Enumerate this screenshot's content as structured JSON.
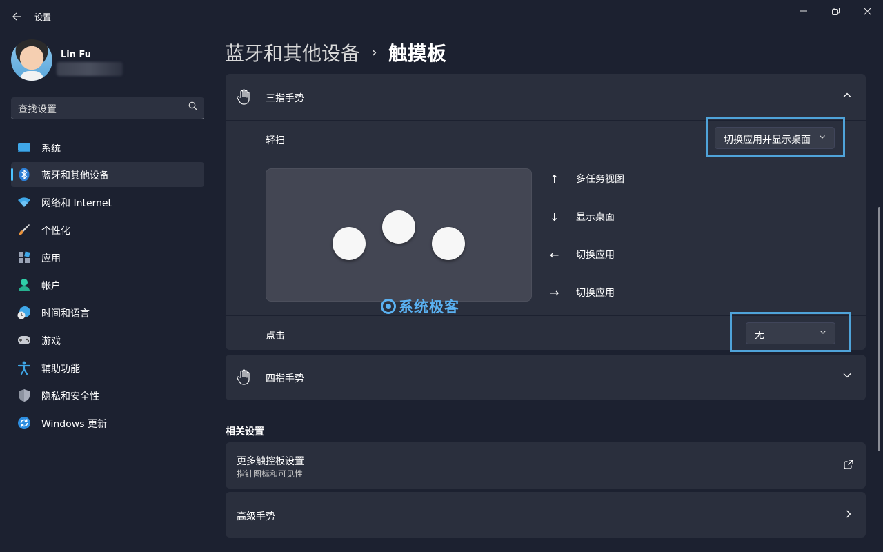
{
  "window": {
    "app_title": "设置",
    "controls": {
      "minimize": "─",
      "maximize": "❐",
      "close": "✕"
    }
  },
  "profile": {
    "name": "Lin Fu"
  },
  "search": {
    "placeholder": "查找设置"
  },
  "sidebar": {
    "items": [
      {
        "label": "系统",
        "icon": "monitor-icon"
      },
      {
        "label": "蓝牙和其他设备",
        "icon": "bluetooth-icon",
        "active": true
      },
      {
        "label": "网络和 Internet",
        "icon": "wifi-icon"
      },
      {
        "label": "个性化",
        "icon": "brush-icon"
      },
      {
        "label": "应用",
        "icon": "apps-icon"
      },
      {
        "label": "帐户",
        "icon": "person-icon"
      },
      {
        "label": "时间和语言",
        "icon": "globe-clock-icon"
      },
      {
        "label": "游戏",
        "icon": "gamepad-icon"
      },
      {
        "label": "辅助功能",
        "icon": "accessibility-icon"
      },
      {
        "label": "隐私和安全性",
        "icon": "shield-icon"
      },
      {
        "label": "Windows 更新",
        "icon": "refresh-icon"
      }
    ]
  },
  "breadcrumb": {
    "parent": "蓝牙和其他设备",
    "separator": "›",
    "current": "触摸板"
  },
  "three_finger": {
    "title": "三指手势",
    "expanded": true,
    "swipe_label": "轻扫",
    "swipe_value": "切换应用并显示桌面",
    "gestures": [
      {
        "arrow": "↑",
        "label": "多任务视图"
      },
      {
        "arrow": "↓",
        "label": "显示桌面"
      },
      {
        "arrow": "←",
        "label": "切换应用"
      },
      {
        "arrow": "→",
        "label": "切换应用"
      }
    ],
    "tap_label": "点击",
    "tap_value": "无"
  },
  "four_finger": {
    "title": "四指手势",
    "expanded": false
  },
  "watermark": "系统极客",
  "related": {
    "title": "相关设置",
    "items": [
      {
        "title": "更多触控板设置",
        "subtitle": "指针图标和可见性",
        "icon": "external-link-icon"
      },
      {
        "title": "高级手势",
        "icon": "chevron-right-icon"
      }
    ]
  },
  "colors": {
    "background": "#1c2130",
    "card": "#2a2f3d",
    "accent": "#4cc2ff",
    "highlight": "#4fa3d9"
  }
}
